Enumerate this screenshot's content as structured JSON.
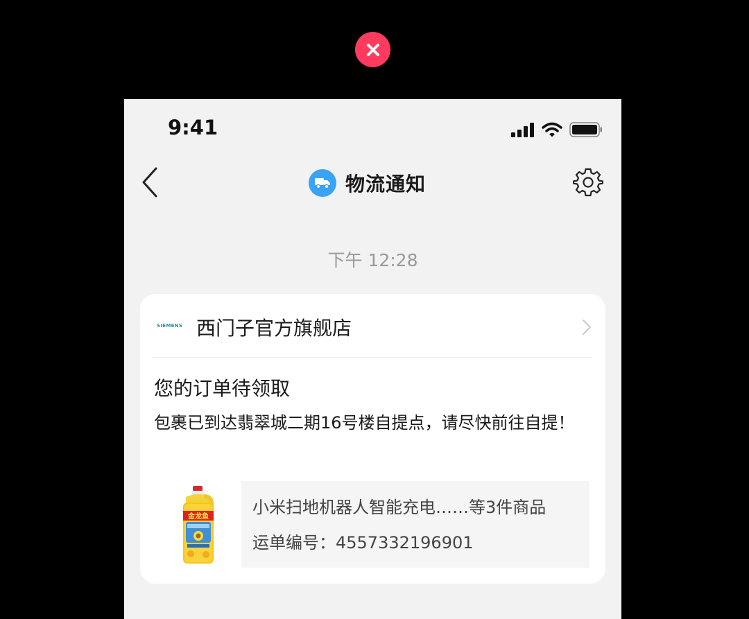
{
  "overlay": {
    "close_icon": "close-icon",
    "close_color": "#fe3b5e"
  },
  "status_bar": {
    "time": "9:41",
    "icons": [
      "signal-icon",
      "wifi-icon",
      "battery-icon"
    ]
  },
  "nav": {
    "title": "物流通知",
    "back_icon": "chevron-left-icon",
    "badge_icon": "truck-icon",
    "badge_color": "#3aa3f5",
    "settings_icon": "gear-icon"
  },
  "message": {
    "time": "下午 12:28",
    "store": {
      "logo_text": "SIEMENS",
      "name": "西门子官方旗舰店"
    },
    "title": "您的订单待领取",
    "description": "包裹已到达翡翠城二期16号楼自提点，请尽快前往自提！",
    "product": {
      "image_icon": "oil-bottle-image",
      "image_label": "金龙鱼",
      "summary": "小米扫地机器人智能充电……等3件商品",
      "tracking": "运单编号：4557332196901"
    }
  }
}
